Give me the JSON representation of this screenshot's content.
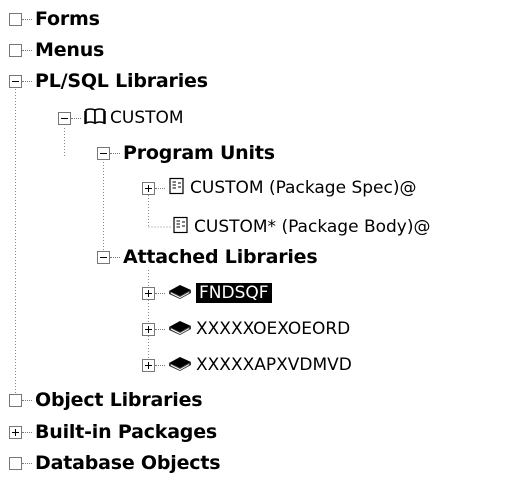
{
  "tree": {
    "forms": {
      "label": "Forms",
      "state": "empty"
    },
    "menus": {
      "label": "Menus",
      "state": "empty"
    },
    "plsql_libraries": {
      "label": "PL/SQL Libraries",
      "state": "expanded",
      "custom": {
        "label": "CUSTOM",
        "icon": "open-book-icon",
        "state": "expanded",
        "program_units": {
          "label": "Program Units",
          "state": "expanded",
          "items": [
            {
              "label": "CUSTOM (Package Spec)@",
              "icon": "package-spec-icon",
              "state": "collapsed"
            },
            {
              "label": "CUSTOM* (Package Body)@",
              "icon": "package-body-icon",
              "state": "leaf"
            }
          ]
        },
        "attached_libraries": {
          "label": "Attached Libraries",
          "state": "expanded",
          "items": [
            {
              "label": "FNDSQF",
              "icon": "library-book-icon",
              "state": "collapsed",
              "selected": true
            },
            {
              "label": "XXXXXOEXOEORD",
              "icon": "library-book-icon",
              "state": "collapsed",
              "selected": false
            },
            {
              "label": "XXXXXAPXVDMVD",
              "icon": "library-book-icon",
              "state": "collapsed",
              "selected": false
            }
          ]
        }
      }
    },
    "object_libraries": {
      "label": "Object Libraries",
      "state": "empty"
    },
    "built_in_packages": {
      "label": "Built-in Packages",
      "state": "collapsed"
    },
    "database_objects": {
      "label": "Database Objects",
      "state": "empty"
    }
  }
}
